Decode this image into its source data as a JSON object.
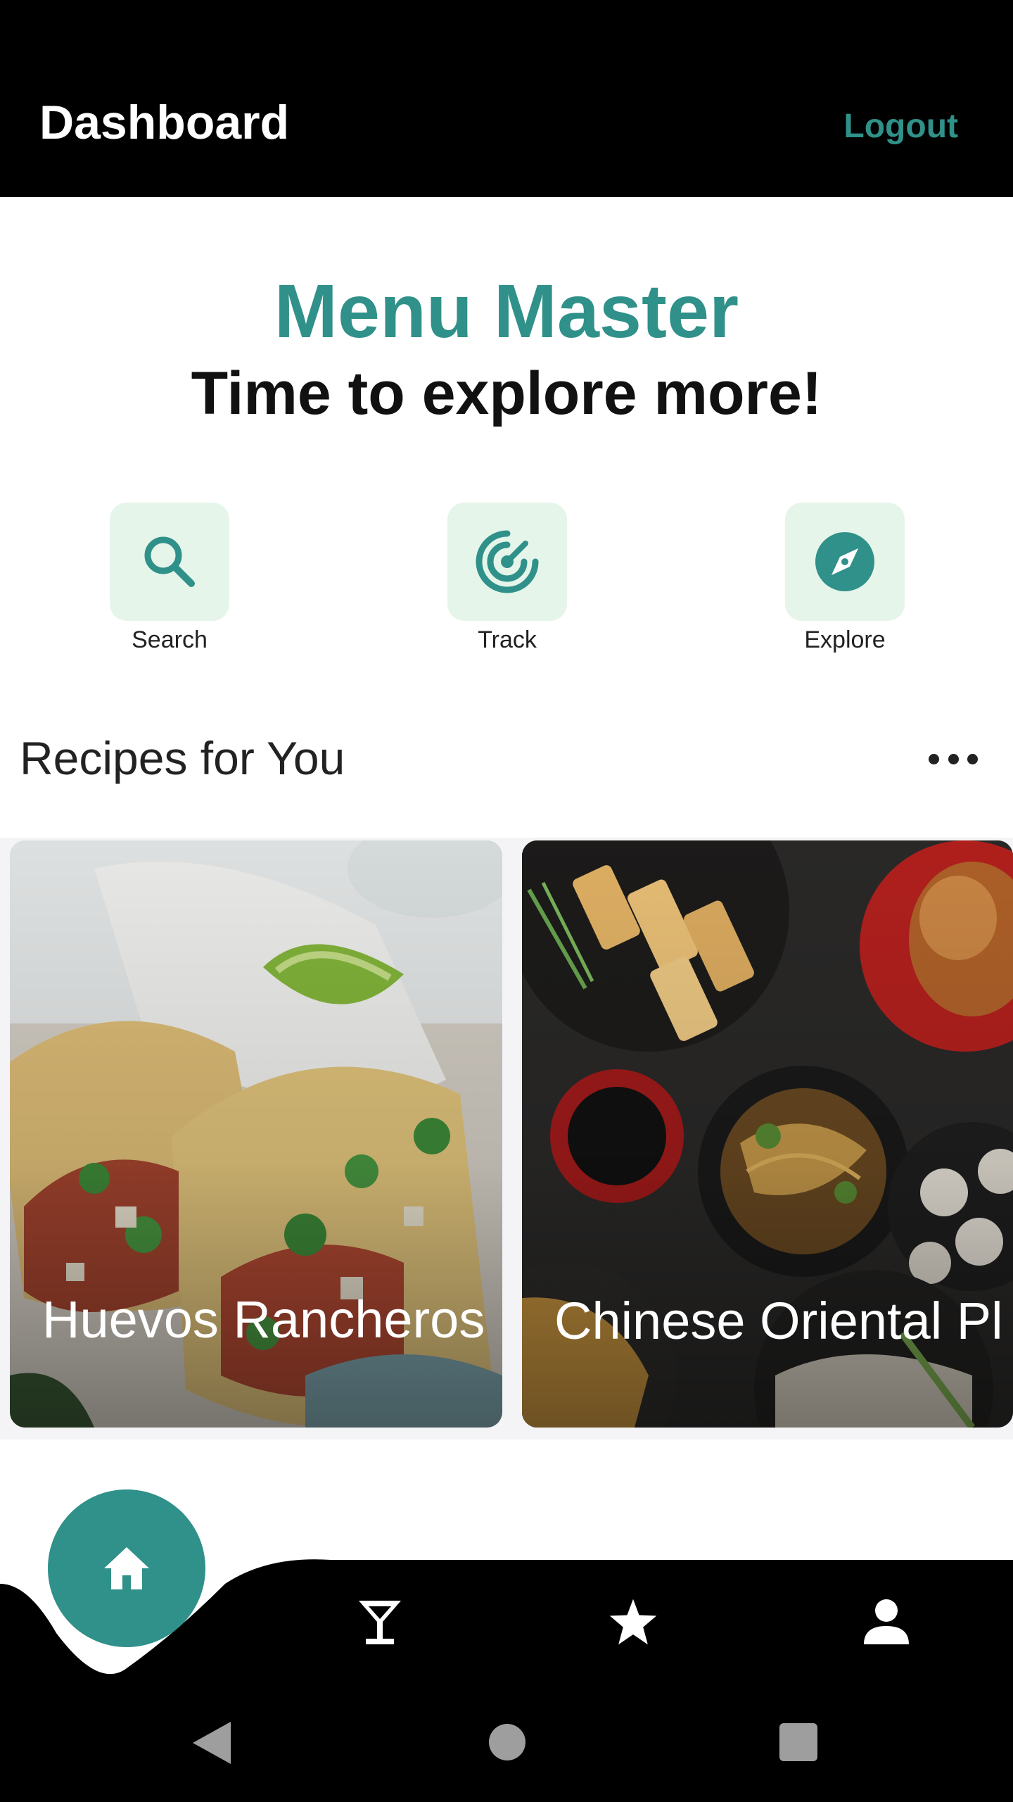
{
  "topbar": {
    "title": "Dashboard",
    "logout_label": "Logout"
  },
  "hero": {
    "title": "Menu Master",
    "subtitle": "Time to explore more!"
  },
  "actions": [
    {
      "label": "Search",
      "icon": "search-icon"
    },
    {
      "label": "Track",
      "icon": "radar-icon"
    },
    {
      "label": "Explore",
      "icon": "compass-icon"
    }
  ],
  "section": {
    "title": "Recipes for You",
    "more_icon": "more-horizontal-icon"
  },
  "recipes": [
    {
      "name": "Huevos Rancheros"
    },
    {
      "name": "Chinese Oriental Pl"
    }
  ],
  "bottom_nav": {
    "items": [
      {
        "icon": "home-icon",
        "active": true
      },
      {
        "icon": "cocktail-icon",
        "active": false
      },
      {
        "icon": "star-icon",
        "active": false
      },
      {
        "icon": "person-icon",
        "active": false
      }
    ]
  },
  "system_nav": [
    "back-icon",
    "home-circle-icon",
    "recents-icon"
  ],
  "colors": {
    "accent": "#2f9189",
    "tile_bg": "#e6f5ea",
    "bar_bg": "#000000",
    "text_dark": "#222222"
  }
}
